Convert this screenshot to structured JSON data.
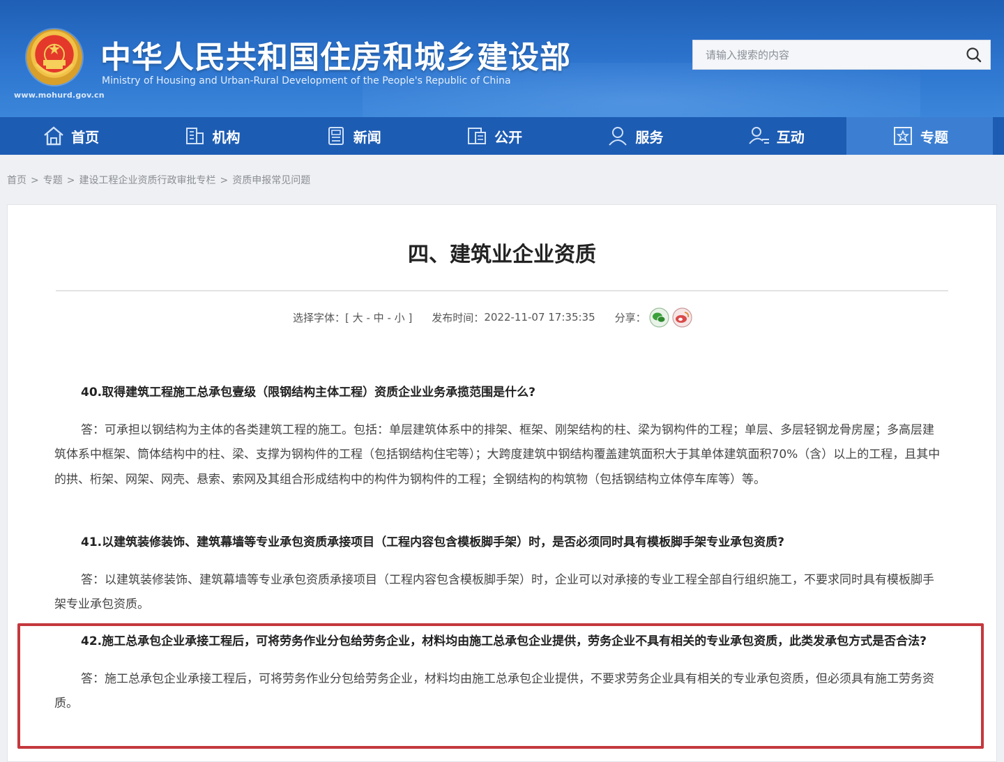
{
  "header": {
    "site_title": "中华人民共和国住房和城乡建设部",
    "site_subtitle": "Ministry of Housing and Urban-Rural Development of the People's Republic of China",
    "site_url": "www.mohurd.gov.cn",
    "search_placeholder": "请输入搜索的内容"
  },
  "nav": {
    "items": [
      {
        "label": "首页",
        "icon": "home-icon"
      },
      {
        "label": "机构",
        "icon": "building-icon"
      },
      {
        "label": "新闻",
        "icon": "news-icon"
      },
      {
        "label": "公开",
        "icon": "open-info-icon"
      },
      {
        "label": "服务",
        "icon": "service-icon"
      },
      {
        "label": "互动",
        "icon": "interaction-icon"
      },
      {
        "label": "专题",
        "icon": "topic-icon"
      }
    ],
    "active": "专题"
  },
  "breadcrumb": {
    "items": [
      "首页",
      "专题",
      "建设工程企业资质行政审批专栏",
      "资质申报常见问题"
    ],
    "separator": ">"
  },
  "article": {
    "title": "四、建筑业企业资质",
    "font_label": "选择字体：[",
    "font_large": "大",
    "font_medium": "中",
    "font_small": "小",
    "font_dash": "-",
    "font_close": "]",
    "publish_label": "发布时间：",
    "publish_time": "2022-11-07 17:35:35",
    "share_label": "分享：",
    "qa": [
      {
        "q": "40.取得建筑工程施工总承包壹级（限钢结构主体工程）资质企业业务承揽范围是什么?",
        "a": "答：可承担以钢结构为主体的各类建筑工程的施工。包括：单层建筑体系中的排架、框架、刚架结构的柱、梁为钢构件的工程；单层、多层轻钢龙骨房屋；多高层建筑体系中框架、筒体结构中的柱、梁、支撑为钢构件的工程（包括钢结构住宅等）；大跨度建筑中钢结构覆盖建筑面积大于其单体建筑面积70%（含）以上的工程，且其中的拱、桁架、网架、网壳、悬索、索网及其组合形成结构中的构件为钢构件的工程；全钢结构的构筑物（包括钢结构立体停车库等）等。"
      },
      {
        "q": "41.以建筑装修装饰、建筑幕墙等专业承包资质承接项目（工程内容包含模板脚手架）时，是否必须同时具有模板脚手架专业承包资质?",
        "a": "答：以建筑装修装饰、建筑幕墙等专业承包资质承接项目（工程内容包含模板脚手架）时，企业可以对承接的专业工程全部自行组织施工，不要求同时具有模板脚手架专业承包资质。"
      },
      {
        "q": "42.施工总承包企业承接工程后，可将劳务作业分包给劳务企业，材料均由施工总承包企业提供，劳务企业不具有相关的专业承包资质，此类发承包方式是否合法?",
        "a": "答：施工总承包企业承接工程后，可将劳务作业分包给劳务企业，材料均由施工总承包企业提供，不要求劳务企业具有相关的专业承包资质，但必须具有施工劳务资质。"
      }
    ]
  },
  "colors": {
    "nav_bg": "#1d5cb3",
    "nav_active": "#3c7fd2",
    "highlight": "#c4383d"
  }
}
